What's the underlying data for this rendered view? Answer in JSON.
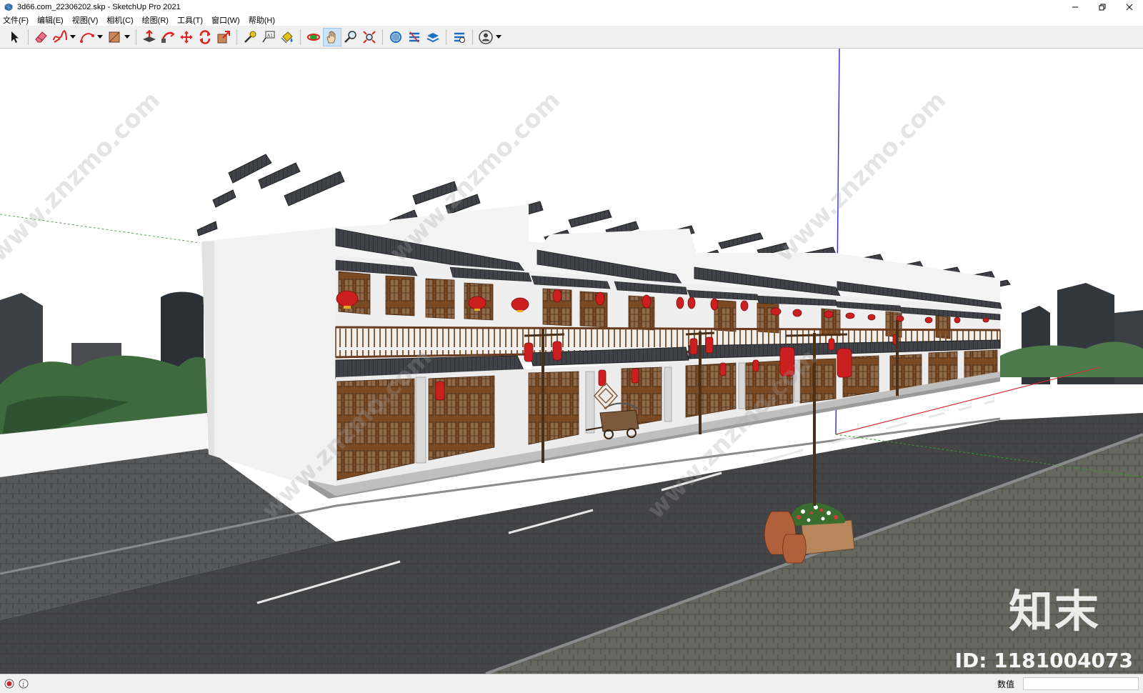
{
  "window": {
    "title": "3d66.com_22306202.skp - SketchUp Pro 2021"
  },
  "menu": {
    "items": [
      {
        "label": "文件(F)"
      },
      {
        "label": "编辑(E)"
      },
      {
        "label": "视图(V)"
      },
      {
        "label": "相机(C)"
      },
      {
        "label": "绘图(R)"
      },
      {
        "label": "工具(T)"
      },
      {
        "label": "窗口(W)"
      },
      {
        "label": "帮助(H)"
      }
    ]
  },
  "toolbar": {
    "tools": [
      "select-icon",
      "eraser-icon",
      "freehand-icon",
      "arc-icon",
      "rectangle-icon",
      "push-pull-icon",
      "follow-me-icon",
      "move-icon",
      "rotate-icon",
      "scale-icon",
      "tape-measure-icon",
      "text-icon",
      "paint-bucket-icon",
      "orbit-icon",
      "pan-icon",
      "zoom-icon",
      "zoom-extents-icon",
      "warehouse-icon",
      "extension-warehouse-icon",
      "layout-icon",
      "extension-manager-icon",
      "account-icon"
    ],
    "active_tool": "pan-icon"
  },
  "viewport": {
    "watermark": "www.znzmo.com",
    "brand": "知末",
    "id_label": "ID: 1181004073"
  },
  "colors": {
    "sky": "#ffffff",
    "wall": "#f2f2f2",
    "roof": "#3c3f45",
    "wood": "#7a4a25",
    "lantern": "#cc1f1f",
    "road": "#3a3b3d",
    "paving": "#5c5d5a",
    "axis_blue": "#3a3ad0",
    "axis_red": "#d23030",
    "axis_green": "#2ea02e"
  },
  "status": {
    "measurements_label": "数值",
    "measurements_value": ""
  }
}
